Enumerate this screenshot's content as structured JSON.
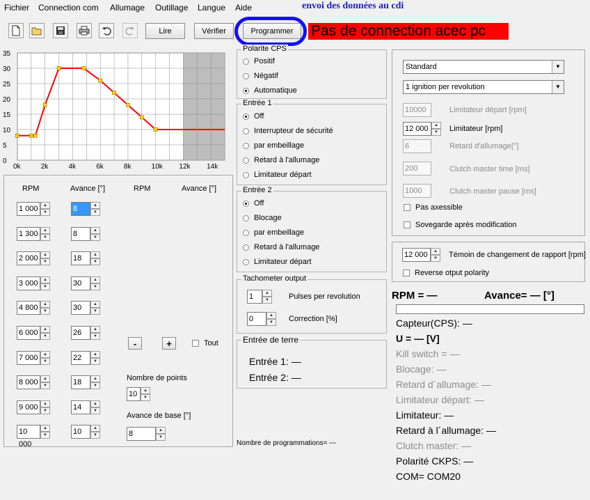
{
  "menu": {
    "items": [
      "Fichier",
      "Connection com",
      "Allumage",
      "Outillage",
      "Langue",
      "Aide"
    ]
  },
  "annotation": "envoi des données au cdi",
  "toolbar": {
    "icons": [
      "new-file-icon",
      "open-folder-icon",
      "save-icon",
      "print-icon",
      "undo-icon",
      "redo-icon"
    ],
    "lire": "Lire",
    "verifier": "Vérifier",
    "programmer": "Programmer",
    "banner": "Pas de connection acec pc",
    "banner_color": "#ff0000"
  },
  "chart_data": {
    "type": "line",
    "x": [
      0,
      1000,
      1300,
      2000,
      3000,
      4800,
      6000,
      7000,
      8000,
      9000,
      10000,
      15000
    ],
    "y": [
      8,
      8,
      8,
      18,
      30,
      30,
      26,
      22,
      18,
      14,
      10,
      10
    ],
    "xlim": [
      0,
      15000
    ],
    "ylim": [
      0,
      35
    ],
    "xticks": [
      "0k",
      "2k",
      "4k",
      "6k",
      "8k",
      "10k",
      "12k",
      "14k"
    ],
    "yticks": [
      "35",
      "30",
      "25",
      "20",
      "15",
      "10",
      "5",
      "0"
    ],
    "line_color": "#ff0000",
    "marker_color": "#ffd700",
    "shaded_from": 12000
  },
  "table": {
    "headers": [
      "RPM",
      "Avance [°]",
      "RPM",
      "Avance [°]"
    ],
    "rows": [
      {
        "rpm": "1 000",
        "adv": "8"
      },
      {
        "rpm": "1 300",
        "adv": "8"
      },
      {
        "rpm": "2 000",
        "adv": "18"
      },
      {
        "rpm": "3 000",
        "adv": "30"
      },
      {
        "rpm": "4 800",
        "adv": "30"
      },
      {
        "rpm": "6 000",
        "adv": "26"
      },
      {
        "rpm": "7 000",
        "adv": "22"
      },
      {
        "rpm": "8 000",
        "adv": "18"
      },
      {
        "rpm": "9 000",
        "adv": "14"
      },
      {
        "rpm": "10 000",
        "adv": "10"
      }
    ],
    "minus": "-",
    "plus": "+",
    "tout": "Tout",
    "nb_points_label": "Nombre de points",
    "nb_points": "10",
    "avance_base_label": "Avance de base [°]",
    "avance_base": "8"
  },
  "polarite": {
    "title": "Polarite CPS",
    "options": [
      "Positif",
      "Négatif",
      "Automatique"
    ],
    "selected": 2
  },
  "entree1": {
    "title": "Entrée 1",
    "options": [
      "Off",
      "Interrupteur de sécurité",
      "par embeillage",
      "Retard à l'allumage",
      "Limitateur départ"
    ],
    "selected": 0
  },
  "entree2": {
    "title": "Entrée 2",
    "options": [
      "Off",
      "Blocage",
      "par embeillage",
      "Retard à l'allumage",
      "Limitateur départ"
    ],
    "selected": 0
  },
  "tacho": {
    "title": "Tachometer output",
    "pulses": "1",
    "pulses_label": "Pulses per revolution",
    "correction": "0",
    "correction_label": "Correction [%]"
  },
  "terre": {
    "title": "Entrée de terre",
    "e1": "Entrée 1: —",
    "e2": "Entrée 2: —"
  },
  "nb_prog": "Nombre de programmations=  ---",
  "right": {
    "select1": "Standard",
    "select2": "1 ignition per revolution",
    "lim_depart": "10000",
    "lim_depart_label": "Limitateur départ [rpm]",
    "lim": "12 000",
    "lim_label": "Limitateur [rpm]",
    "retard": "6",
    "retard_label": "Retard d'allumage[°]",
    "clutch_time": "200",
    "clutch_time_label": "Clutch master time [ms]",
    "clutch_pause": "1000",
    "clutch_pause_label": "Clutch master pause [ms]",
    "pas_axessible": "Pas axessible",
    "sovegarde": "Sovegarde après modification",
    "temoin": "12 000",
    "temoin_label": "Témoin de changement de rapport [rpm]",
    "reverse": "Reverse otput polarity"
  },
  "status": {
    "rpm": "RPM = —",
    "avance": "Avance= — [°]",
    "capteur": "Capteur(CPS): —",
    "u": "U = — [V]",
    "kill": "Kill switch = —",
    "blocage": "Blocage: —",
    "retard": "Retard d´allumage: —",
    "lim_depart": "Limitateur départ: —",
    "lim": "Limitateur: —",
    "retard2": "Retard à l´allumage: —",
    "clutch": "Clutch master: —",
    "polarite": "Polarité CKPS: —",
    "com": "COM= COM20"
  }
}
